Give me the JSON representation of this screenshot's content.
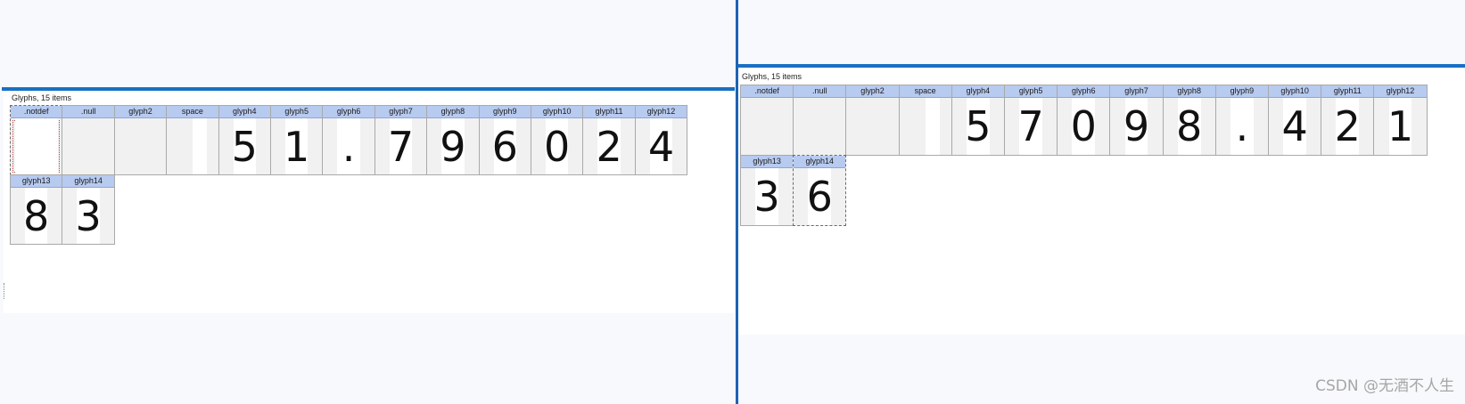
{
  "panes": [
    {
      "title": "Glyphs, 15 items",
      "selected_index": 0,
      "glyphs": [
        {
          "name": ".notdef",
          "char": ""
        },
        {
          "name": ".null",
          "char": ""
        },
        {
          "name": "glyph2",
          "char": ""
        },
        {
          "name": "space",
          "char": ""
        },
        {
          "name": "glyph4",
          "char": "5"
        },
        {
          "name": "glyph5",
          "char": "1"
        },
        {
          "name": "glyph6",
          "char": "."
        },
        {
          "name": "glyph7",
          "char": "7"
        },
        {
          "name": "glyph8",
          "char": "9"
        },
        {
          "name": "glyph9",
          "char": "6"
        },
        {
          "name": "glyph10",
          "char": "0"
        },
        {
          "name": "glyph11",
          "char": "2"
        },
        {
          "name": "glyph12",
          "char": "4"
        },
        {
          "name": "glyph13",
          "char": "8"
        },
        {
          "name": "glyph14",
          "char": "3"
        }
      ]
    },
    {
      "title": "Glyphs, 15 items",
      "selected_index": 14,
      "glyphs": [
        {
          "name": ".notdef",
          "char": ""
        },
        {
          "name": ".null",
          "char": ""
        },
        {
          "name": "glyph2",
          "char": ""
        },
        {
          "name": "space",
          "char": ""
        },
        {
          "name": "glyph4",
          "char": "5"
        },
        {
          "name": "glyph5",
          "char": "7"
        },
        {
          "name": "glyph6",
          "char": "0"
        },
        {
          "name": "glyph7",
          "char": "9"
        },
        {
          "name": "glyph8",
          "char": "8"
        },
        {
          "name": "glyph9",
          "char": "."
        },
        {
          "name": "glyph10",
          "char": "4"
        },
        {
          "name": "glyph11",
          "char": "2"
        },
        {
          "name": "glyph12",
          "char": "1"
        },
        {
          "name": "glyph13",
          "char": "3"
        },
        {
          "name": "glyph14",
          "char": "6"
        }
      ]
    }
  ],
  "watermark": "CSDN @无酒不人生"
}
